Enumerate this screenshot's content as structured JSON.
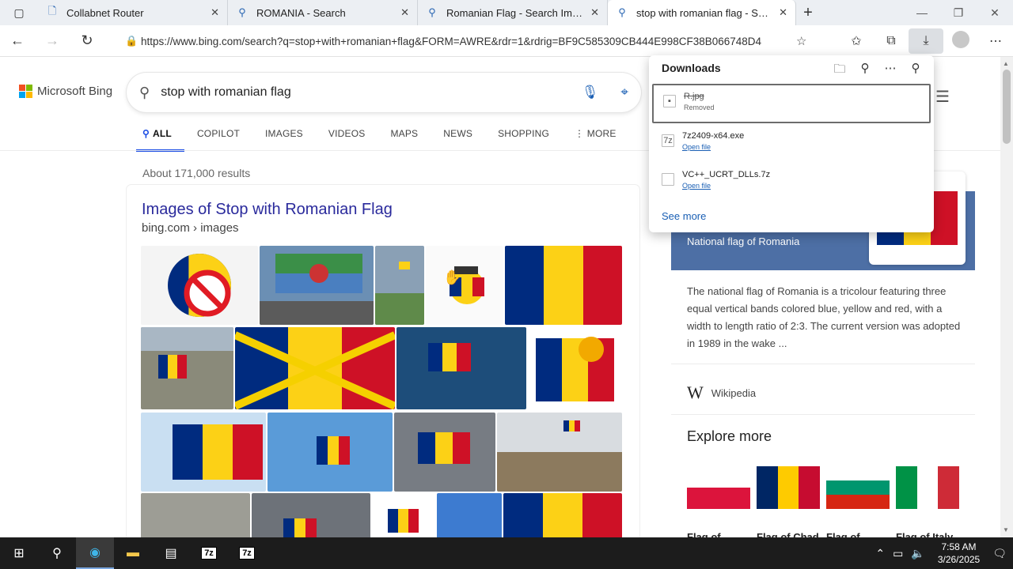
{
  "tabs": [
    {
      "label": "Collabnet Router",
      "icon": "page-icon",
      "active": false
    },
    {
      "label": "ROMANIA - Search",
      "icon": "search-icon",
      "active": false
    },
    {
      "label": "Romanian Flag - Search Images",
      "icon": "search-icon",
      "active": false
    },
    {
      "label": "stop with romanian flag - Search",
      "icon": "search-icon",
      "active": true
    }
  ],
  "address": {
    "url": "https://www.bing.com/search?q=stop+with+romanian+flag&FORM=AWRE&rdr=1&rdrig=BF9C585309CB444E998CF38B066748D4"
  },
  "bing": {
    "logo_text": "Microsoft Bing",
    "query": "stop with romanian flag",
    "scopes": [
      "ALL",
      "COPILOT",
      "IMAGES",
      "VIDEOS",
      "MAPS",
      "NEWS",
      "SHOPPING",
      "MORE"
    ],
    "result_count": "About 171,000 results"
  },
  "result": {
    "title": "Images of Stop with Romanian Flag",
    "url": "bing.com › images"
  },
  "knowledge_panel": {
    "hero_title": "National flag of Romania",
    "description": "The national flag of Romania is a tricolour featuring three equal vertical bands colored blue, yellow and red, with a width to length ratio of 2:3. The current version was adopted in 1989 in the wake ...",
    "source": "Wikipedia",
    "explore_title": "Explore more",
    "explore_items": [
      {
        "label": "Flag of",
        "colors": [
          "#ffffff",
          "#dc143c"
        ]
      },
      {
        "label": "Flag of Chad",
        "colors": [
          "#002664",
          "#fecb00",
          "#c60c30"
        ]
      },
      {
        "label": "Flag of",
        "colors": [
          "#ffffff",
          "#00966e",
          "#d62612"
        ]
      },
      {
        "label": "Flag of Italy",
        "colors": [
          "#009246",
          "#ffffff",
          "#ce2b37"
        ]
      }
    ]
  },
  "downloads": {
    "title": "Downloads",
    "items": [
      {
        "name": "R.jpg",
        "status": "Removed"
      },
      {
        "name": "7z2409-x64.exe",
        "status": "Open file"
      },
      {
        "name": "VC++_UCRT_DLLs.7z",
        "status": "Open file"
      }
    ],
    "see_more": "See more"
  },
  "taskbar": {
    "time": "7:58 AM",
    "date": "3/26/2025"
  },
  "colors": {
    "romania_blue": "#002b7f",
    "romania_yellow": "#fcd116",
    "romania_red": "#ce1126",
    "bing_accent": "#174ae4"
  }
}
